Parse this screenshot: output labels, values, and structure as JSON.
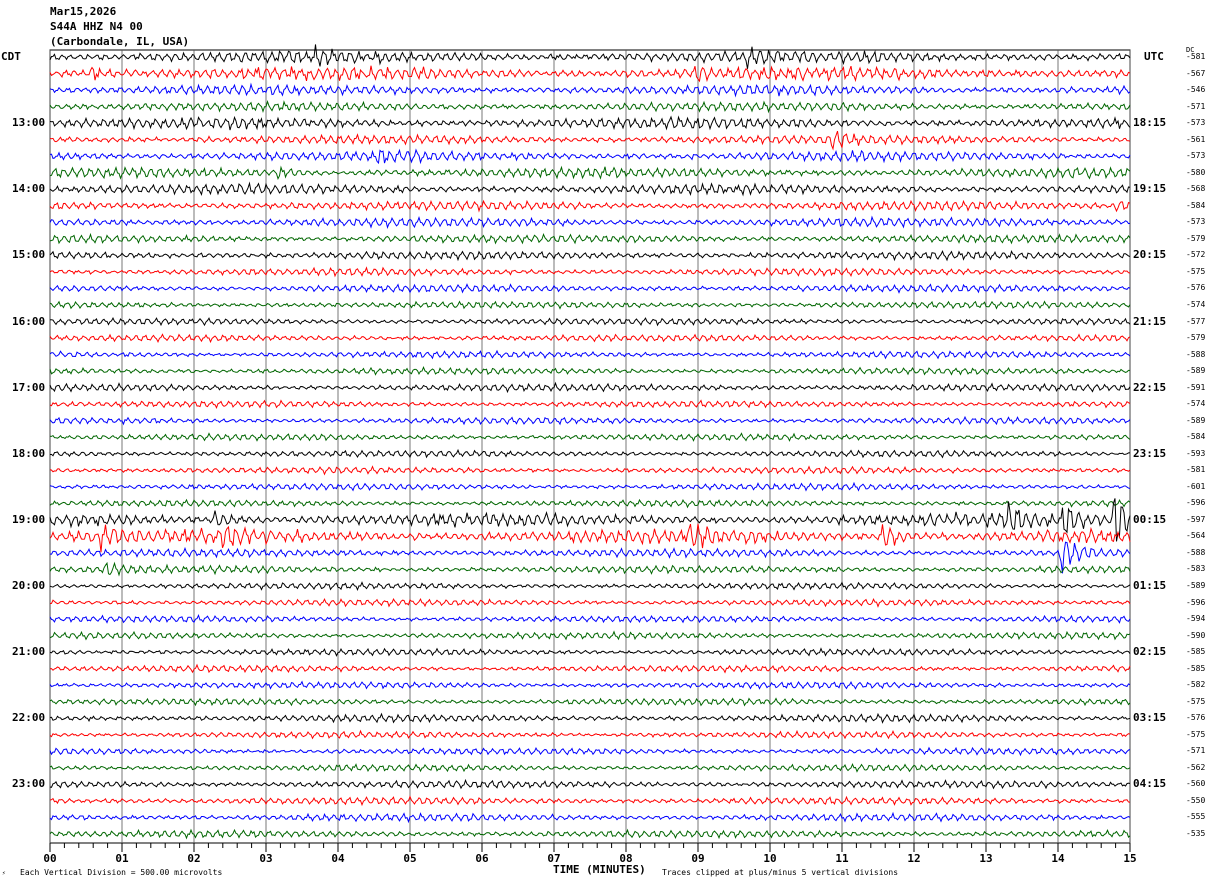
{
  "header": {
    "date": "Mar15,2026",
    "station": "S44A HHZ N4 00",
    "location": "(Carbondale, IL, USA)"
  },
  "left_tz": "CDT",
  "right_tz": "UTC",
  "dc_label": "DC",
  "footer": {
    "scale": "Each Vertical Division =  500.00 microvolts",
    "xlabel": "TIME (MINUTES)",
    "clip": "Traces clipped at plus/minus 5 vertical divisions"
  },
  "chart_data": {
    "type": "line",
    "title": "S44A HHZ N4 00 helicorder",
    "xlabel": "TIME (MINUTES)",
    "xlim": [
      0,
      15
    ],
    "x_ticks": [
      "00",
      "01",
      "02",
      "03",
      "04",
      "05",
      "06",
      "07",
      "08",
      "09",
      "10",
      "11",
      "12",
      "13",
      "14",
      "15"
    ],
    "trace_colors": [
      "#000000",
      "#ff0000",
      "#0000ff",
      "#006600"
    ],
    "left_hour_labels": [
      "13:00",
      "14:00",
      "15:00",
      "16:00",
      "17:00",
      "18:00",
      "19:00",
      "20:00",
      "21:00",
      "22:00",
      "23:00"
    ],
    "right_hour_labels": [
      "18:15",
      "19:15",
      "20:15",
      "21:15",
      "22:15",
      "23:15",
      "00:15",
      "01:15",
      "02:15",
      "03:15",
      "04:15"
    ],
    "dc_offsets": [
      "-581",
      "-567",
      "-546",
      "-571",
      "-573",
      "-561",
      "-573",
      "-580",
      "-568",
      "-584",
      "-573",
      "-579",
      "-572",
      "-575",
      "-576",
      "-574",
      "-577",
      "-579",
      "-588",
      "-589",
      "-591",
      "-574",
      "-589",
      "-584",
      "-593",
      "-581",
      "-601",
      "-596",
      "-597",
      "-564",
      "-588",
      "-583",
      "-589",
      "-596",
      "-594",
      "-590",
      "-585",
      "-585",
      "-582",
      "-575",
      "-576",
      "-575",
      "-571",
      "-562",
      "-560",
      "-550",
      "-555",
      "-535"
    ],
    "noise_level": [
      1.4,
      1.5,
      1.2,
      1.1,
      1.3,
      1.1,
      1.2,
      1.2,
      1.2,
      1.1,
      1.1,
      1.0,
      1.0,
      0.9,
      0.9,
      0.8,
      0.8,
      0.8,
      0.8,
      0.8,
      0.9,
      0.8,
      0.8,
      0.8,
      0.8,
      0.8,
      0.8,
      0.8,
      1.5,
      1.6,
      1.0,
      0.9,
      0.8,
      0.8,
      0.8,
      0.8,
      0.8,
      0.8,
      0.8,
      0.8,
      0.9,
      0.8,
      0.8,
      0.8,
      0.9,
      0.9,
      0.9,
      0.9
    ],
    "events": [
      {
        "trace": 1,
        "minute": 0.6,
        "amp": 2.0
      },
      {
        "trace": 0,
        "minute": 3.7,
        "amp": 2.0
      },
      {
        "trace": 1,
        "minute": 9.0,
        "amp": 2.0
      },
      {
        "trace": 0,
        "minute": 9.7,
        "amp": 2.0
      },
      {
        "trace": 6,
        "minute": 4.6,
        "amp": 2.0
      },
      {
        "trace": 5,
        "minute": 10.9,
        "amp": 2.2
      },
      {
        "trace": 7,
        "minute": 3.2,
        "amp": 2.0
      },
      {
        "trace": 9,
        "minute": 14.8,
        "amp": 2.0
      },
      {
        "trace": 28,
        "minute": 2.3,
        "amp": 2.5
      },
      {
        "trace": 29,
        "minute": 0.7,
        "amp": 3.5
      },
      {
        "trace": 29,
        "minute": 2.4,
        "amp": 3.0
      },
      {
        "trace": 29,
        "minute": 8.9,
        "amp": 3.5
      },
      {
        "trace": 29,
        "minute": 11.6,
        "amp": 3.5
      },
      {
        "trace": 31,
        "minute": 0.8,
        "amp": 2.0
      },
      {
        "trace": 28,
        "minute": 13.3,
        "amp": 6
      },
      {
        "trace": 28,
        "minute": 14.1,
        "amp": 5
      },
      {
        "trace": 28,
        "minute": 14.8,
        "amp": 10
      },
      {
        "trace": 30,
        "minute": 14.05,
        "amp": 8
      }
    ]
  }
}
